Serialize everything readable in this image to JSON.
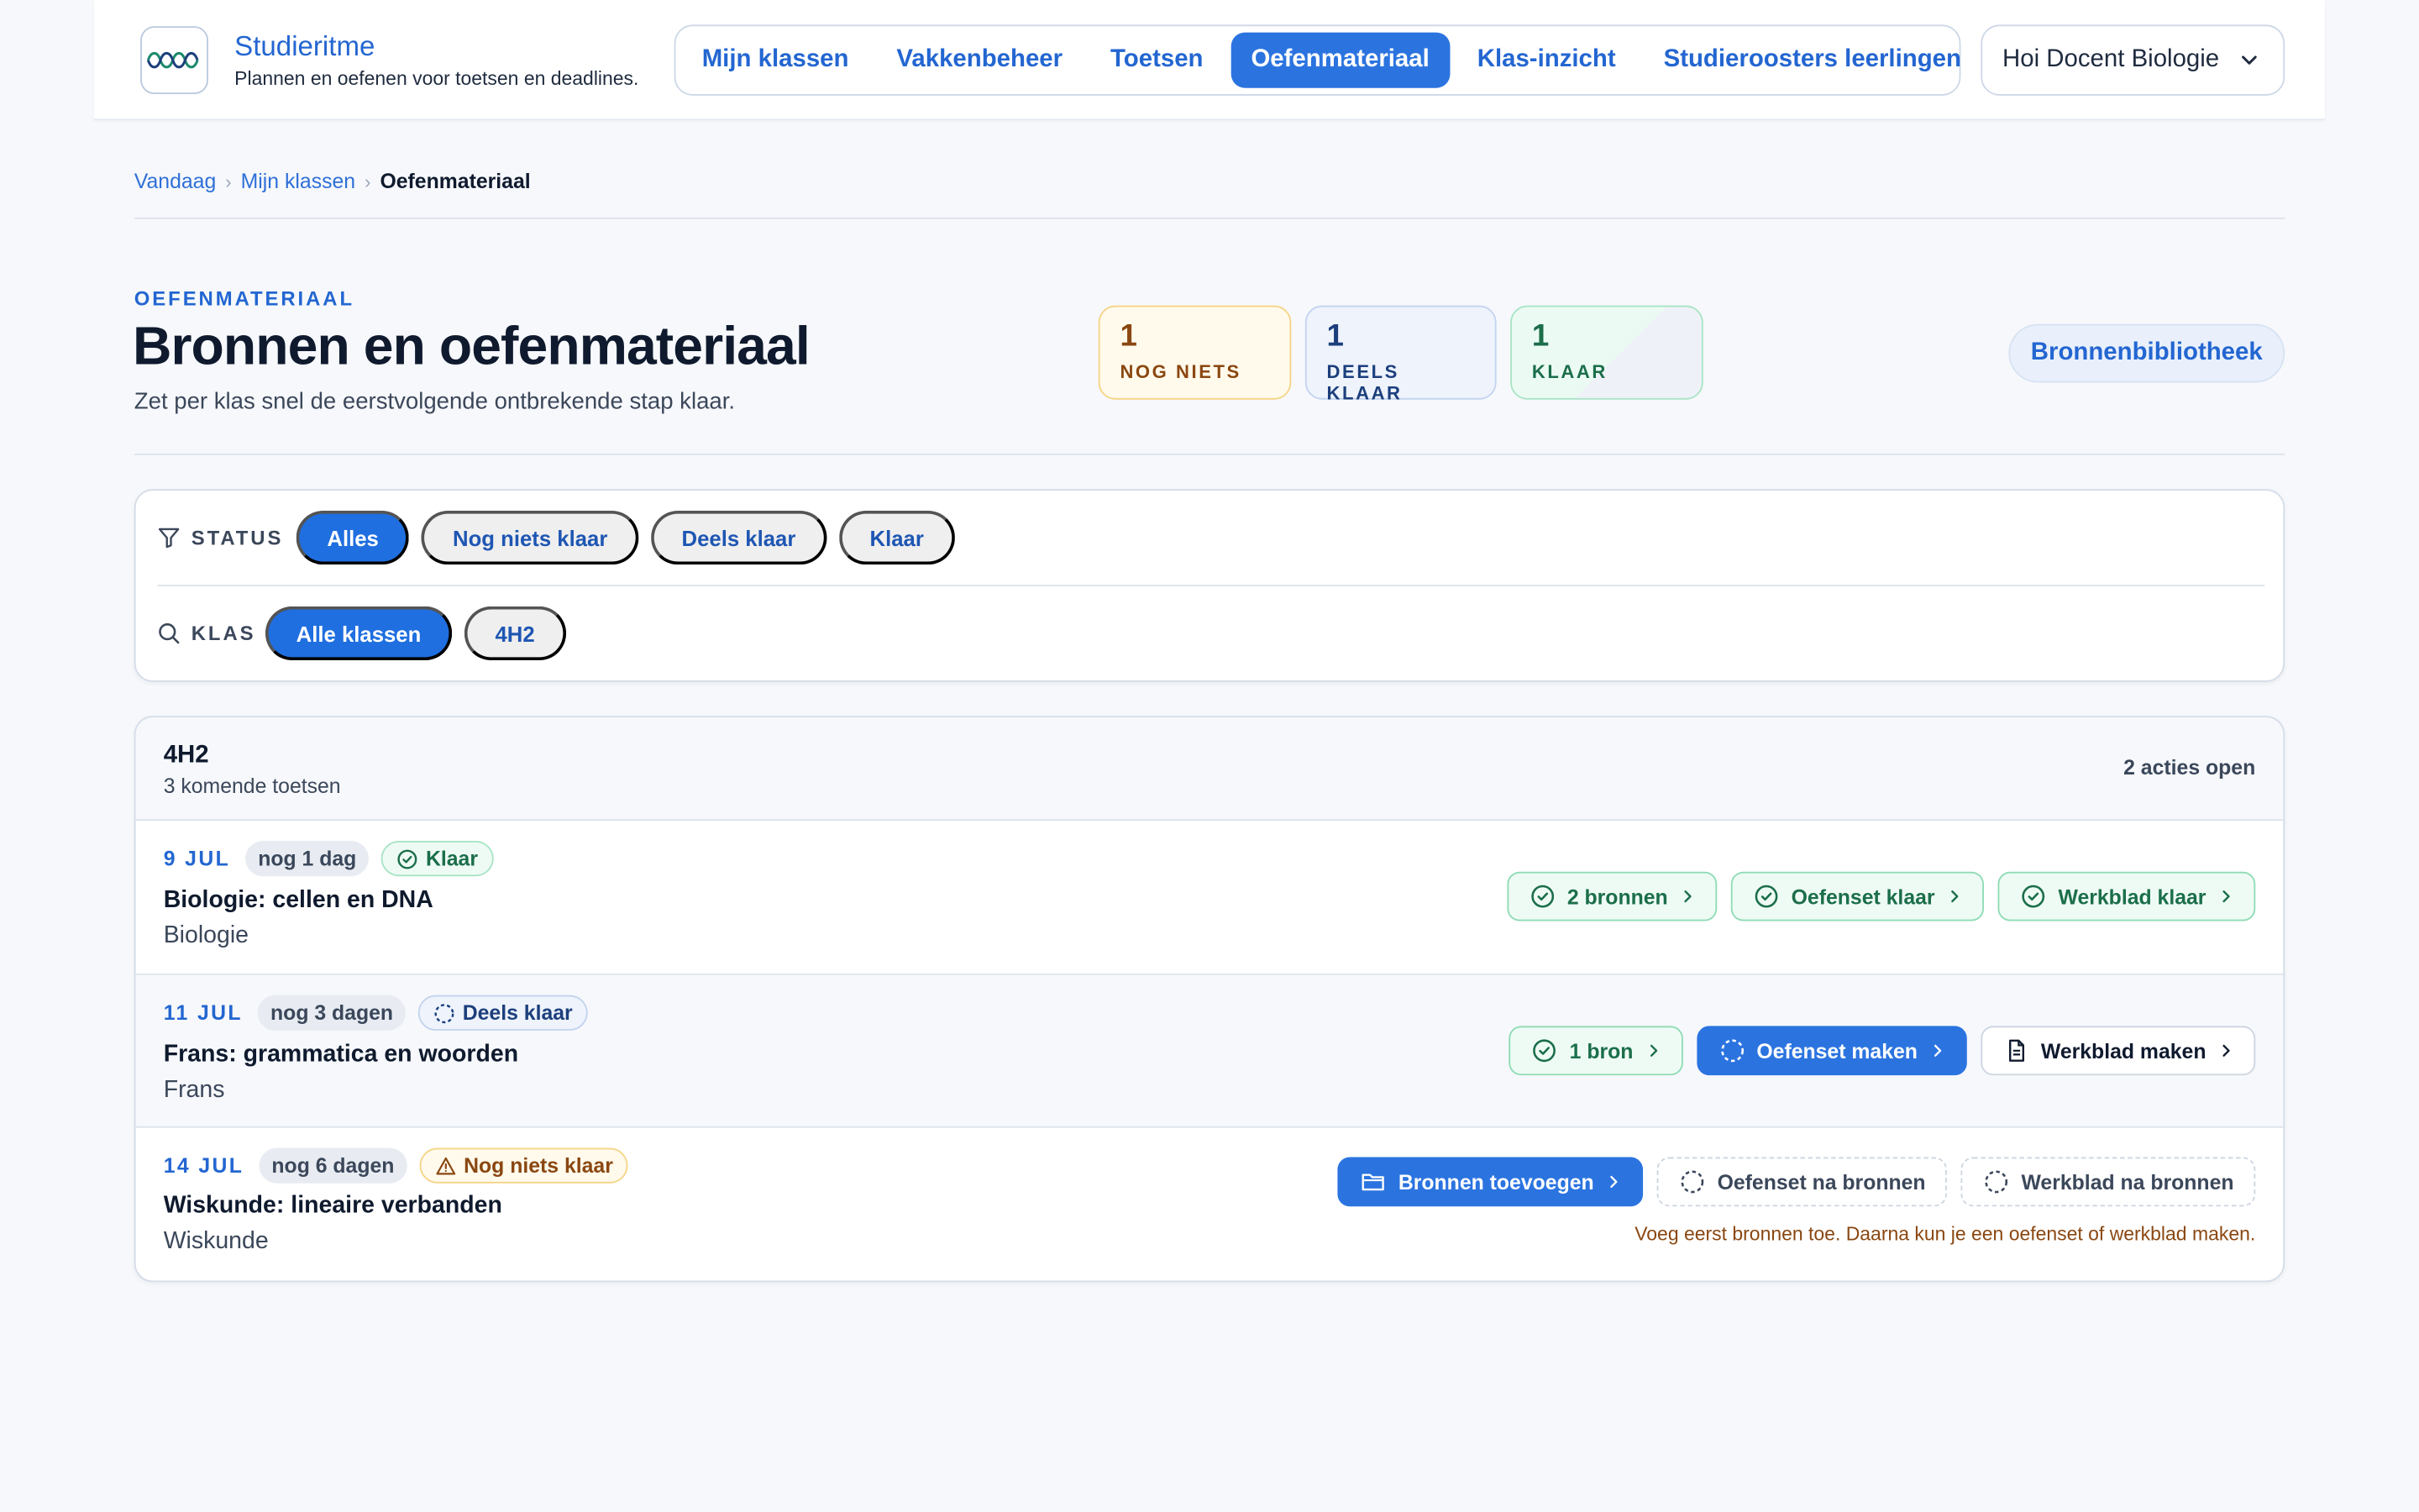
{
  "brand": {
    "name": "Studieritme",
    "tagline": "Plannen en oefenen voor toetsen en deadlines."
  },
  "nav": {
    "items": [
      {
        "label": "Mijn klassen",
        "active": false
      },
      {
        "label": "Vakkenbeheer",
        "active": false
      },
      {
        "label": "Toetsen",
        "active": false
      },
      {
        "label": "Oefenmateriaal",
        "active": true
      },
      {
        "label": "Klas-inzicht",
        "active": false
      },
      {
        "label": "Studieroosters leerlingen",
        "active": false
      }
    ],
    "user_label": "Hoi Docent Biologie"
  },
  "breadcrumb": {
    "items": [
      "Vandaag",
      "Mijn klassen"
    ],
    "current": "Oefenmateriaal"
  },
  "page": {
    "eyebrow": "OEFENMATERIAAL",
    "title": "Bronnen en oefenmateriaal",
    "subtitle": "Zet per klas snel de eerstvolgende ontbrekende stap klaar.",
    "library_button": "Bronnenbibliotheek"
  },
  "stats": {
    "none": {
      "count": "1",
      "label": "NOG NIETS"
    },
    "partial": {
      "count": "1",
      "label": "DEELS KLAAR"
    },
    "done": {
      "count": "1",
      "label": "KLAAR"
    }
  },
  "filters": {
    "status_label": "STATUS",
    "status_options": [
      "Alles",
      "Nog niets klaar",
      "Deels klaar",
      "Klaar"
    ],
    "status_selected": "Alles",
    "class_label": "KLAS",
    "class_options": [
      "Alle klassen",
      "4H2"
    ],
    "class_selected": "Alle klassen"
  },
  "class_group": {
    "name": "4H2",
    "subtitle": "3 komende toetsen",
    "open_actions": "2 acties open",
    "tests": [
      {
        "date": "9 JUL",
        "days_left": "nog 1 dag",
        "status": "Klaar",
        "title": "Biologie: cellen en DNA",
        "subject": "Biologie",
        "actions": [
          "2 bronnen",
          "Oefenset klaar",
          "Werkblad klaar"
        ]
      },
      {
        "date": "11 JUL",
        "days_left": "nog 3 dagen",
        "status": "Deels klaar",
        "title": "Frans: grammatica en woorden",
        "subject": "Frans",
        "actions": [
          "1 bron",
          "Oefenset maken",
          "Werkblad maken"
        ]
      },
      {
        "date": "14 JUL",
        "days_left": "nog 6 dagen",
        "status": "Nog niets klaar",
        "title": "Wiskunde: lineaire verbanden",
        "subject": "Wiskunde",
        "actions": [
          "Bronnen toevoegen",
          "Oefenset na bronnen",
          "Werkblad na bronnen"
        ],
        "hint": "Voeg eerst bronnen toe. Daarna kun je een oefenset of werkblad maken."
      }
    ]
  },
  "colors": {
    "accent": "#2b74e0",
    "done": "#1b6e4a",
    "partial": "#1c3f7c",
    "none": "#8a4711",
    "background": "#f6f8fb"
  },
  "icons": {
    "logo": "wave-logo-icon",
    "user_menu": "chevron-down-icon",
    "status_filter": "filter-icon",
    "class_filter": "search-icon",
    "done": "check-circle-icon",
    "partial": "dashed-circle-icon",
    "none": "warning-triangle-icon",
    "sources": "folder-icon",
    "worksheet": "document-icon",
    "action_arrow": "chevron-right-icon"
  }
}
